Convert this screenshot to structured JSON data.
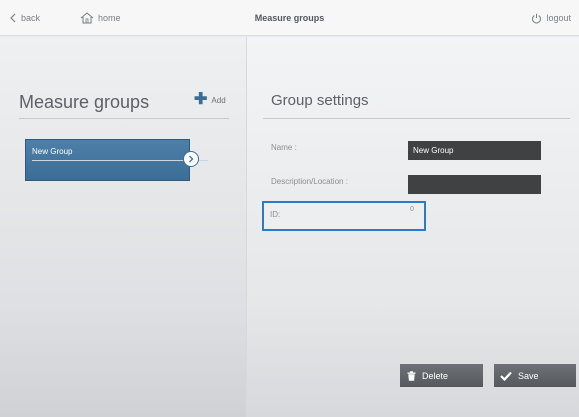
{
  "topbar": {
    "back_label": "back",
    "home_label": "home",
    "title": "Measure groups",
    "logout_label": "logout"
  },
  "left_panel": {
    "title": "Measure groups",
    "add_label": "Add",
    "groups": [
      {
        "label": "New Group",
        "selected": true
      }
    ]
  },
  "right_panel": {
    "title": "Group settings",
    "name_label": "Name :",
    "name_value": "New Group",
    "description_label": "Description/Location :",
    "description_value": "",
    "id_label": "ID:",
    "id_value": "0"
  },
  "actions": {
    "delete_label": "Delete",
    "save_label": "Save"
  },
  "icons": {
    "back": "chevron-left-icon",
    "home": "home-icon",
    "logout": "power-icon",
    "add": "plus-icon",
    "group_arrow": "chevron-right-circle-icon",
    "delete": "trash-icon",
    "save": "checkmark-icon"
  },
  "colors": {
    "accent": "#3c6d96",
    "highlight_border": "#2b79c7",
    "input_bg": "#3f4143",
    "button_bg": "#5f6266"
  }
}
